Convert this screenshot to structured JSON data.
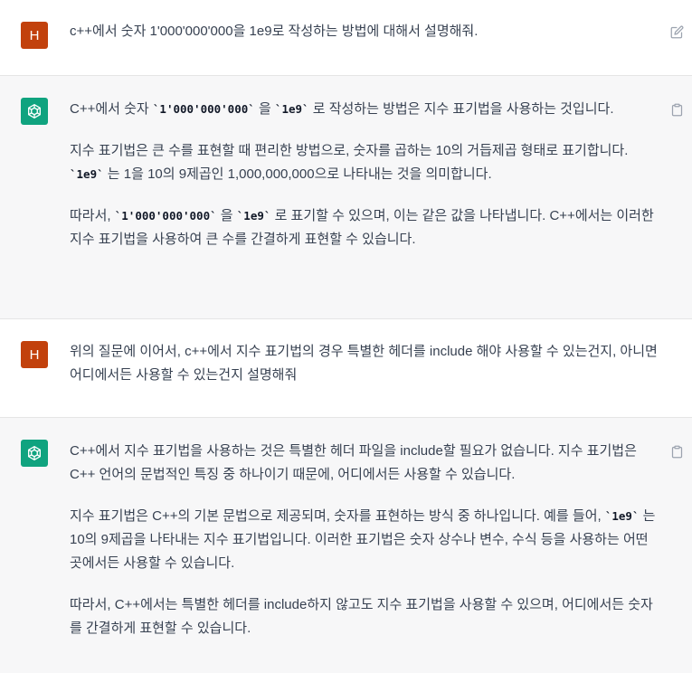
{
  "messages": [
    {
      "role": "user",
      "avatar_letter": "H",
      "action_icon": "edit-icon",
      "text": "c++에서 숫자 1'000'000'000을 1e9로 작성하는 방법에 대해서 설명해줘."
    },
    {
      "role": "assistant",
      "action_icon": "clipboard-icon",
      "p1": {
        "a": "C++에서 숫자 ",
        "c1": "`1'000'000'000`",
        "b": " 을 ",
        "c2": "`1e9`",
        "d": " 로 작성하는 방법은 지수 표기법을 사용하는 것입니다."
      },
      "p2": {
        "a": "지수 표기법은 큰 수를 표현할 때 편리한 방법으로, 숫자를 곱하는 10의 거듭제곱 형태로 표기합니다. ",
        "c1": "`1e9`",
        "b": " 는 1을 10의 9제곱인 1,000,000,000으로 나타내는 것을 의미합니다."
      },
      "p3": {
        "a": "따라서, ",
        "c1": "`1'000'000'000`",
        "b": " 을 ",
        "c2": "`1e9`",
        "d": " 로 표기할 수 있으며, 이는 같은 값을 나타냅니다. C++에서는 이러한 지수 표기법을 사용하여 큰 수를 간결하게 표현할 수 있습니다."
      }
    },
    {
      "role": "user",
      "avatar_letter": "H",
      "text": "위의 질문에 이어서, c++에서 지수 표기법의 경우 특별한 헤더를 include 해야 사용할 수 있는건지, 아니면 어디에서든 사용할 수 있는건지 설명해줘"
    },
    {
      "role": "assistant",
      "action_icon": "clipboard-icon",
      "p1": "C++에서 지수 표기법을 사용하는 것은 특별한 헤더 파일을 include할 필요가 없습니다. 지수 표기법은 C++ 언어의 문법적인 특징 중 하나이기 때문에, 어디에서든 사용할 수 있습니다.",
      "p2": {
        "a": "지수 표기법은 C++의 기본 문법으로 제공되며, 숫자를 표현하는 방식 중 하나입니다. 예를 들어, ",
        "c1": "`1e9`",
        "b": " 는 10의 9제곱을 나타내는 지수 표기법입니다. 이러한 표기법은 숫자 상수나 변수, 수식 등을 사용하는 어떤 곳에서든 사용할 수 있습니다."
      },
      "p3": "따라서, C++에서는 특별한 헤더를 include하지 않고도 지수 표기법을 사용할 수 있으며, 어디에서든 숫자를 간결하게 표현할 수 있습니다."
    }
  ],
  "colors": {
    "user_avatar": "#c2410c",
    "assistant_avatar": "#10a37f",
    "assistant_bg": "#f7f7f8",
    "text": "#374151"
  }
}
